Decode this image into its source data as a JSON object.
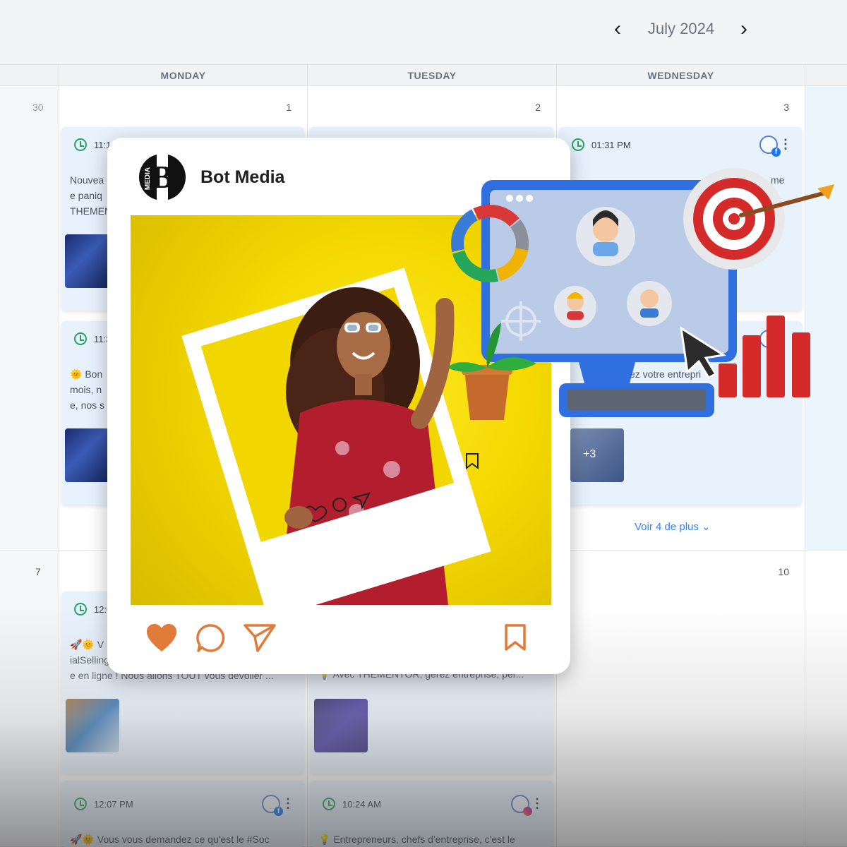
{
  "header": {
    "prev_icon": "chevron-left-icon",
    "next_icon": "chevron-right-icon",
    "month": "July 2024"
  },
  "days": [
    "MONDAY",
    "TUESDAY",
    "WEDNESDAY"
  ],
  "dates": {
    "d30": "30",
    "d1": "1",
    "d2": "2",
    "d3": "3",
    "d7": "7",
    "d10": "10"
  },
  "posts": {
    "mon1": {
      "time": "11:18",
      "text": "Nouvea\ne paniq\nTHEMEN"
    },
    "wed1": {
      "time": "01:31 PM",
      "text": "me"
    },
    "mon2": {
      "time": "11:3",
      "text": "🌞 Bon\nmois, n\ne, nos s"
    },
    "wed2": {
      "text": "ez votre entrepri",
      "more_label": "+3"
    },
    "mon3": {
      "time": "12:0",
      "text": "🚀🌞 V\nialSelling\ne en ligne ! Nous allons TOUT vous dévoiler ..."
    },
    "tue3": {
      "text": "💡 Avec THEMENTOR, gérez entreprise, per..."
    },
    "mon4": {
      "time": "12:07 PM",
      "text": "🚀🌞 Vous vous demandez ce qu'est le #Soc"
    },
    "tue4": {
      "time": "10:24 AM",
      "text": "💡 Entrepreneurs, chefs d'entreprise, c'est le"
    }
  },
  "see_more": "Voir 4 de plus ⌄",
  "card": {
    "brand": "Bot Media",
    "logo_letter": "B",
    "logo_text": "MEDIA"
  },
  "colors": {
    "accent": "#3b82f6",
    "ig_action": "#e07b39",
    "photo_bg": "#f4d800",
    "clock": "#22a45d"
  }
}
